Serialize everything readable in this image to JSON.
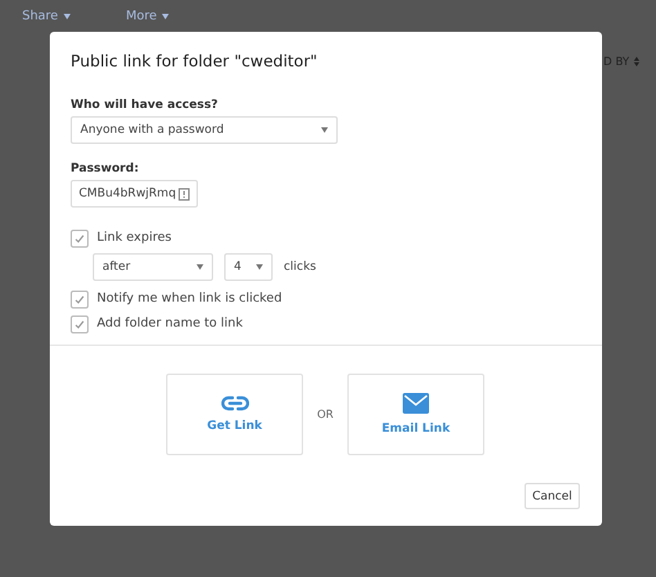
{
  "background": {
    "toolbar": [
      "Share",
      "More"
    ],
    "sort_label": "D BY"
  },
  "dialog": {
    "title": "Public link for folder \"cweditor\"",
    "access": {
      "label": "Who will have access?",
      "value": "Anyone with a password"
    },
    "password": {
      "label": "Password:",
      "value": "CMBu4bRwjRmq"
    },
    "expires": {
      "label": "Link expires",
      "checked": true,
      "mode": "after",
      "count": "4",
      "unit": "clicks"
    },
    "options": [
      {
        "label": "Notify me when link is clicked",
        "checked": true
      },
      {
        "label": "Add folder name to link",
        "checked": true
      }
    ],
    "actions": [
      {
        "kind": "link",
        "label": "Get Link"
      },
      {
        "kind": "email",
        "label": "Email Link"
      }
    ],
    "separator": "OR",
    "cancel": "Cancel"
  }
}
